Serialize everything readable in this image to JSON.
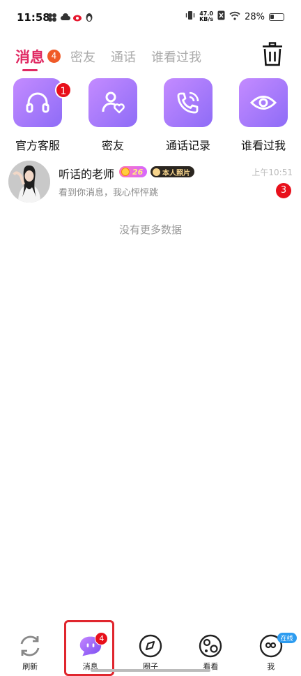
{
  "status_bar": {
    "time": "11:58",
    "net_speed_value": "47.0",
    "net_speed_unit": "KB/s",
    "battery": "28%"
  },
  "tabs": [
    {
      "label": "消息",
      "badge": "4",
      "active": true
    },
    {
      "label": "密友"
    },
    {
      "label": "通话"
    },
    {
      "label": "谁看过我"
    }
  ],
  "quick_actions": [
    {
      "label": "官方客服",
      "icon": "headset-icon",
      "badge": "1"
    },
    {
      "label": "密友",
      "icon": "friend-heart-icon"
    },
    {
      "label": "通话记录",
      "icon": "phone-call-icon"
    },
    {
      "label": "谁看过我",
      "icon": "eye-icon"
    }
  ],
  "conversation": {
    "name": "听话的老师",
    "level": "26",
    "verify_label": "本人照片",
    "message": "看到你消息，我心怦怦跳",
    "time": "上午10:51",
    "unread": "3"
  },
  "no_more_text": "没有更多数据",
  "bottom_nav": [
    {
      "label": "刷新",
      "icon": "refresh-icon"
    },
    {
      "label": "消息",
      "icon": "chat-bubble-icon",
      "badge": "4",
      "active": true
    },
    {
      "label": "圈子",
      "icon": "compass-icon"
    },
    {
      "label": "看看",
      "icon": "planet-icon"
    },
    {
      "label": "我",
      "icon": "profile-face-icon",
      "status_badge": "在线"
    }
  ],
  "colors": {
    "accent": "#e02a63",
    "icon_gradient_start": "#c48bff",
    "icon_gradient_end": "#8e6cf7",
    "badge": "#e8101b"
  }
}
